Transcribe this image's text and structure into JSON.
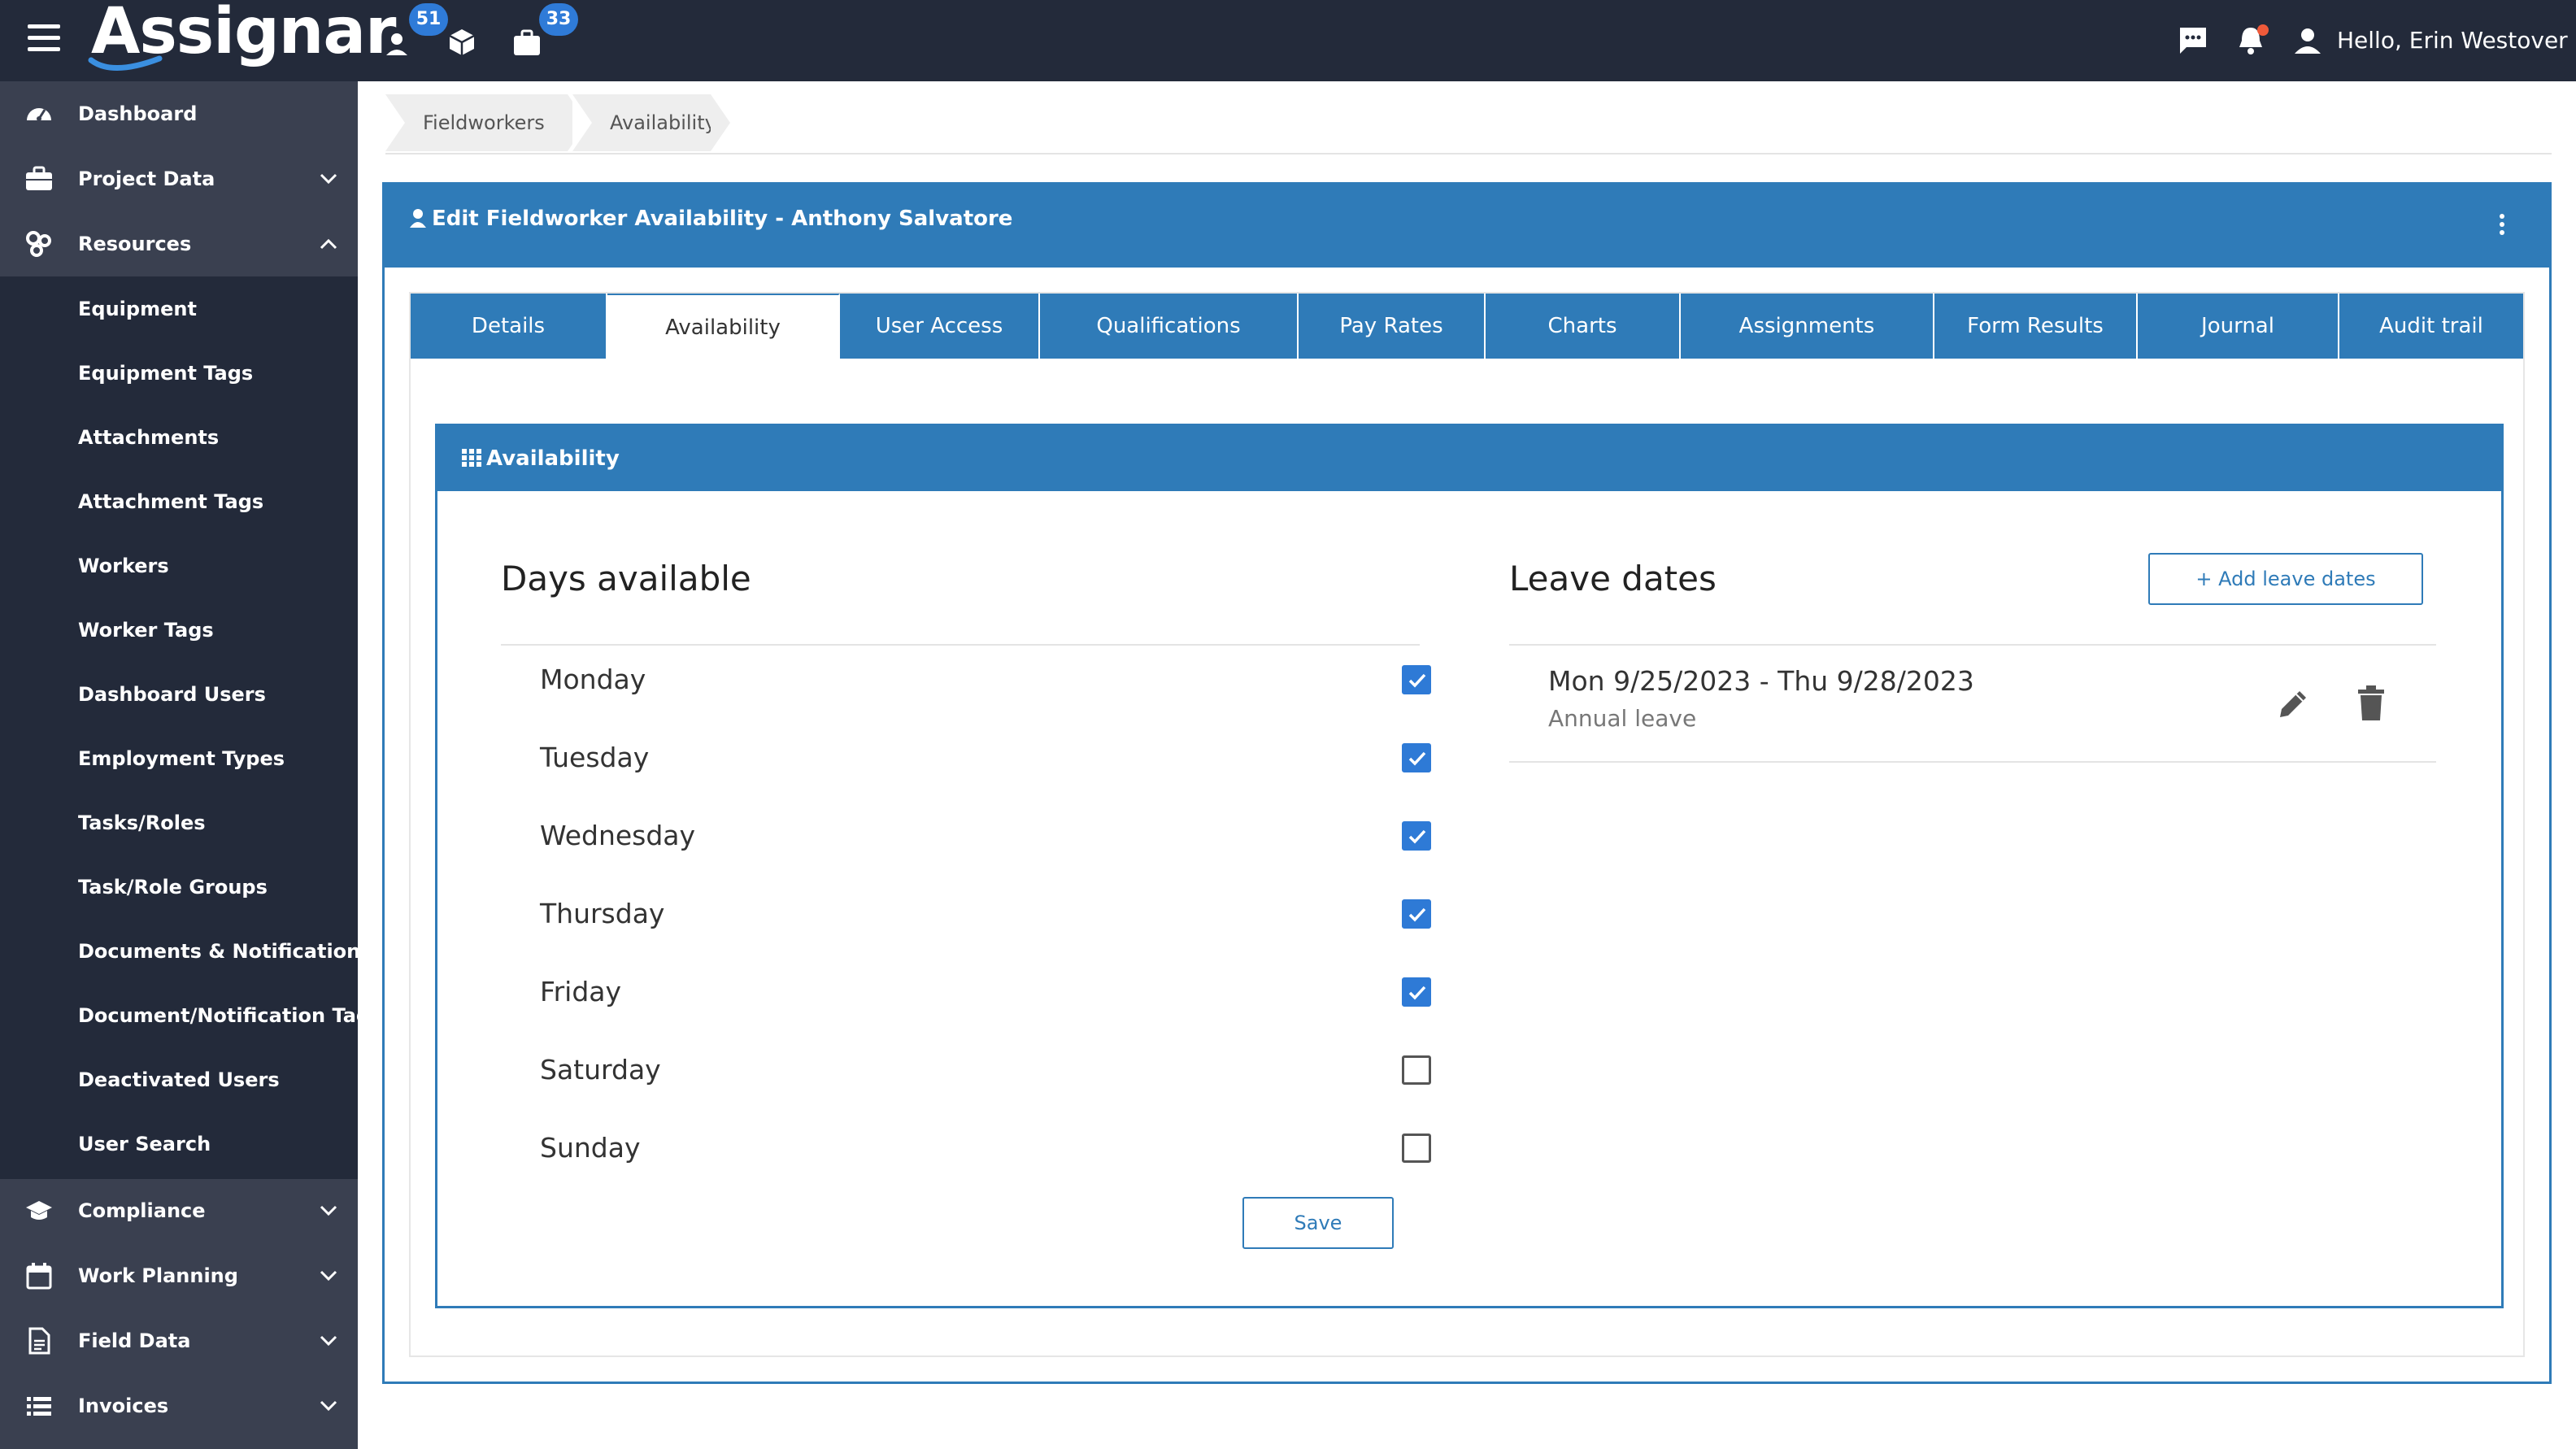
{
  "topbar": {
    "logo_text": "Assignar",
    "badge_workers": "51",
    "badge_jobs": "33",
    "greeting": "Hello, Erin Westover"
  },
  "sidebar": {
    "items": [
      {
        "label": "Dashboard",
        "icon": "dashboard-icon"
      },
      {
        "label": "Project Data",
        "icon": "briefcase-icon"
      },
      {
        "label": "Resources",
        "icon": "resources-icon"
      }
    ],
    "resources_submenu": [
      "Equipment",
      "Equipment Tags",
      "Attachments",
      "Attachment Tags",
      "Workers",
      "Worker Tags",
      "Dashboard Users",
      "Employment Types",
      "Tasks/Roles",
      "Task/Role Groups",
      "Documents & Notifications",
      "Document/Notification Tags",
      "Deactivated Users",
      "User Search"
    ],
    "bottom_items": [
      {
        "label": "Compliance",
        "icon": "graduation-cap-icon"
      },
      {
        "label": "Work Planning",
        "icon": "calendar-icon"
      },
      {
        "label": "Field Data",
        "icon": "document-icon"
      },
      {
        "label": "Invoices",
        "icon": "list-icon"
      }
    ]
  },
  "breadcrumb": {
    "items": [
      "Fieldworkers",
      "Availability"
    ]
  },
  "panel": {
    "title": "Edit Fieldworker Availability - Anthony Salvatore"
  },
  "tabs": [
    "Details",
    "Availability",
    "User Access",
    "Qualifications",
    "Pay Rates",
    "Charts",
    "Assignments",
    "Form Results",
    "Journal",
    "Audit trail"
  ],
  "active_tab": "Availability",
  "availability": {
    "section_title": "Availability",
    "days_title": "Days available",
    "days": [
      {
        "name": "Monday",
        "checked": true
      },
      {
        "name": "Tuesday",
        "checked": true
      },
      {
        "name": "Wednesday",
        "checked": true
      },
      {
        "name": "Thursday",
        "checked": true
      },
      {
        "name": "Friday",
        "checked": true
      },
      {
        "name": "Saturday",
        "checked": false
      },
      {
        "name": "Sunday",
        "checked": false
      }
    ],
    "save_label": "Save",
    "leave_title": "Leave dates",
    "add_leave_label": "+ Add leave dates",
    "leave_entries": [
      {
        "range": "Mon 9/25/2023 - Thu 9/28/2023",
        "type": "Annual leave"
      }
    ]
  },
  "colors": {
    "topbar": "#232a3a",
    "sidebar": "#3a4050",
    "accent": "#2f7bb8",
    "checkbox": "#2e7ad6",
    "badge": "#2f7bd8"
  }
}
